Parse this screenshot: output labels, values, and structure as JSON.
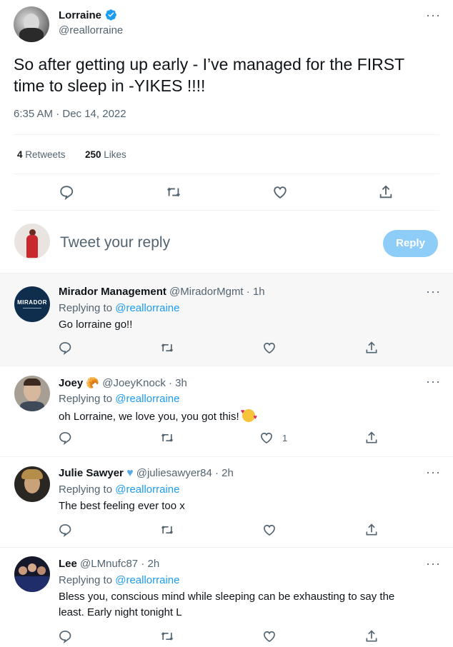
{
  "main_tweet": {
    "author_name": "Lorraine",
    "author_handle": "@reallorraine",
    "text_line1": "So after getting up early - I’ve managed for the FIRST",
    "text_line2": "time to sleep in -YIKES !!!!",
    "timestamp": "6:35 AM · Dec 14, 2022",
    "retweets_count": "4",
    "retweets_label": "Retweets",
    "likes_count": "250",
    "likes_label": "Likes"
  },
  "composer": {
    "placeholder": "Tweet your reply",
    "reply_button": "Reply"
  },
  "replies": [
    {
      "name": "Mirador Management",
      "handle": "@MiradorMgmt",
      "time": "· 1h",
      "replying_prefix": "Replying to",
      "replying_to": "@reallorraine",
      "text": "Go lorraine go!!",
      "like_count": ""
    },
    {
      "name": "Joey",
      "handle": "@JoeyKnock",
      "time": "· 3h",
      "replying_prefix": "Replying to",
      "replying_to": "@reallorraine",
      "text": "oh Lorraine, we love you, you got this!",
      "like_count": "1"
    },
    {
      "name": "Julie Sawyer",
      "handle": "@juliesawyer84",
      "time": "· 2h",
      "replying_prefix": "Replying to",
      "replying_to": "@reallorraine",
      "text": "The best feeling ever too x",
      "like_count": ""
    },
    {
      "name": "Lee",
      "handle": "@LMnufc87",
      "time": "· 2h",
      "replying_prefix": "Replying to",
      "replying_to": "@reallorraine",
      "text_line1": "Bless you, conscious mind while sleeping can be exhausting to say the",
      "text_line2": "least. Early night tonight L",
      "like_count": ""
    }
  ],
  "mirador_logo_text": "MIRADOR",
  "colors": {
    "accent": "#1d9bf0",
    "reply_button_bg": "#8ecdf8",
    "muted": "#536471",
    "divider": "#eff3f4",
    "highlight_bg": "#f7f7f7",
    "verified": "#1d9bf0"
  }
}
